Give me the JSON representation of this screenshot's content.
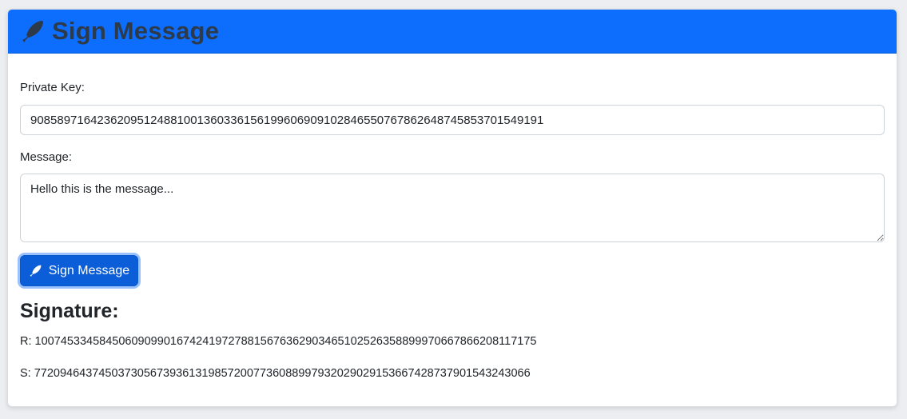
{
  "header": {
    "title": "Sign Message",
    "icon": "feather-pen-icon"
  },
  "form": {
    "private_key_label": "Private Key:",
    "private_key_value": "90858971642362095124881001360336156199606909102846550767862648745853701549191",
    "message_label": "Message:",
    "message_value": "Hello this is the message...",
    "sign_button_label": "Sign Message"
  },
  "signature": {
    "title": "Signature:",
    "r_line": "R: 100745334584506090990167424197278815676362903465102526358899970667866208117175",
    "s_line": "S: 77209464374503730567393613198572007736088997932029029153667428737901543243066"
  },
  "colors": {
    "header_bg": "#0d6efd",
    "button_bg": "#0b5ed7",
    "header_text": "#2d3a4a"
  }
}
